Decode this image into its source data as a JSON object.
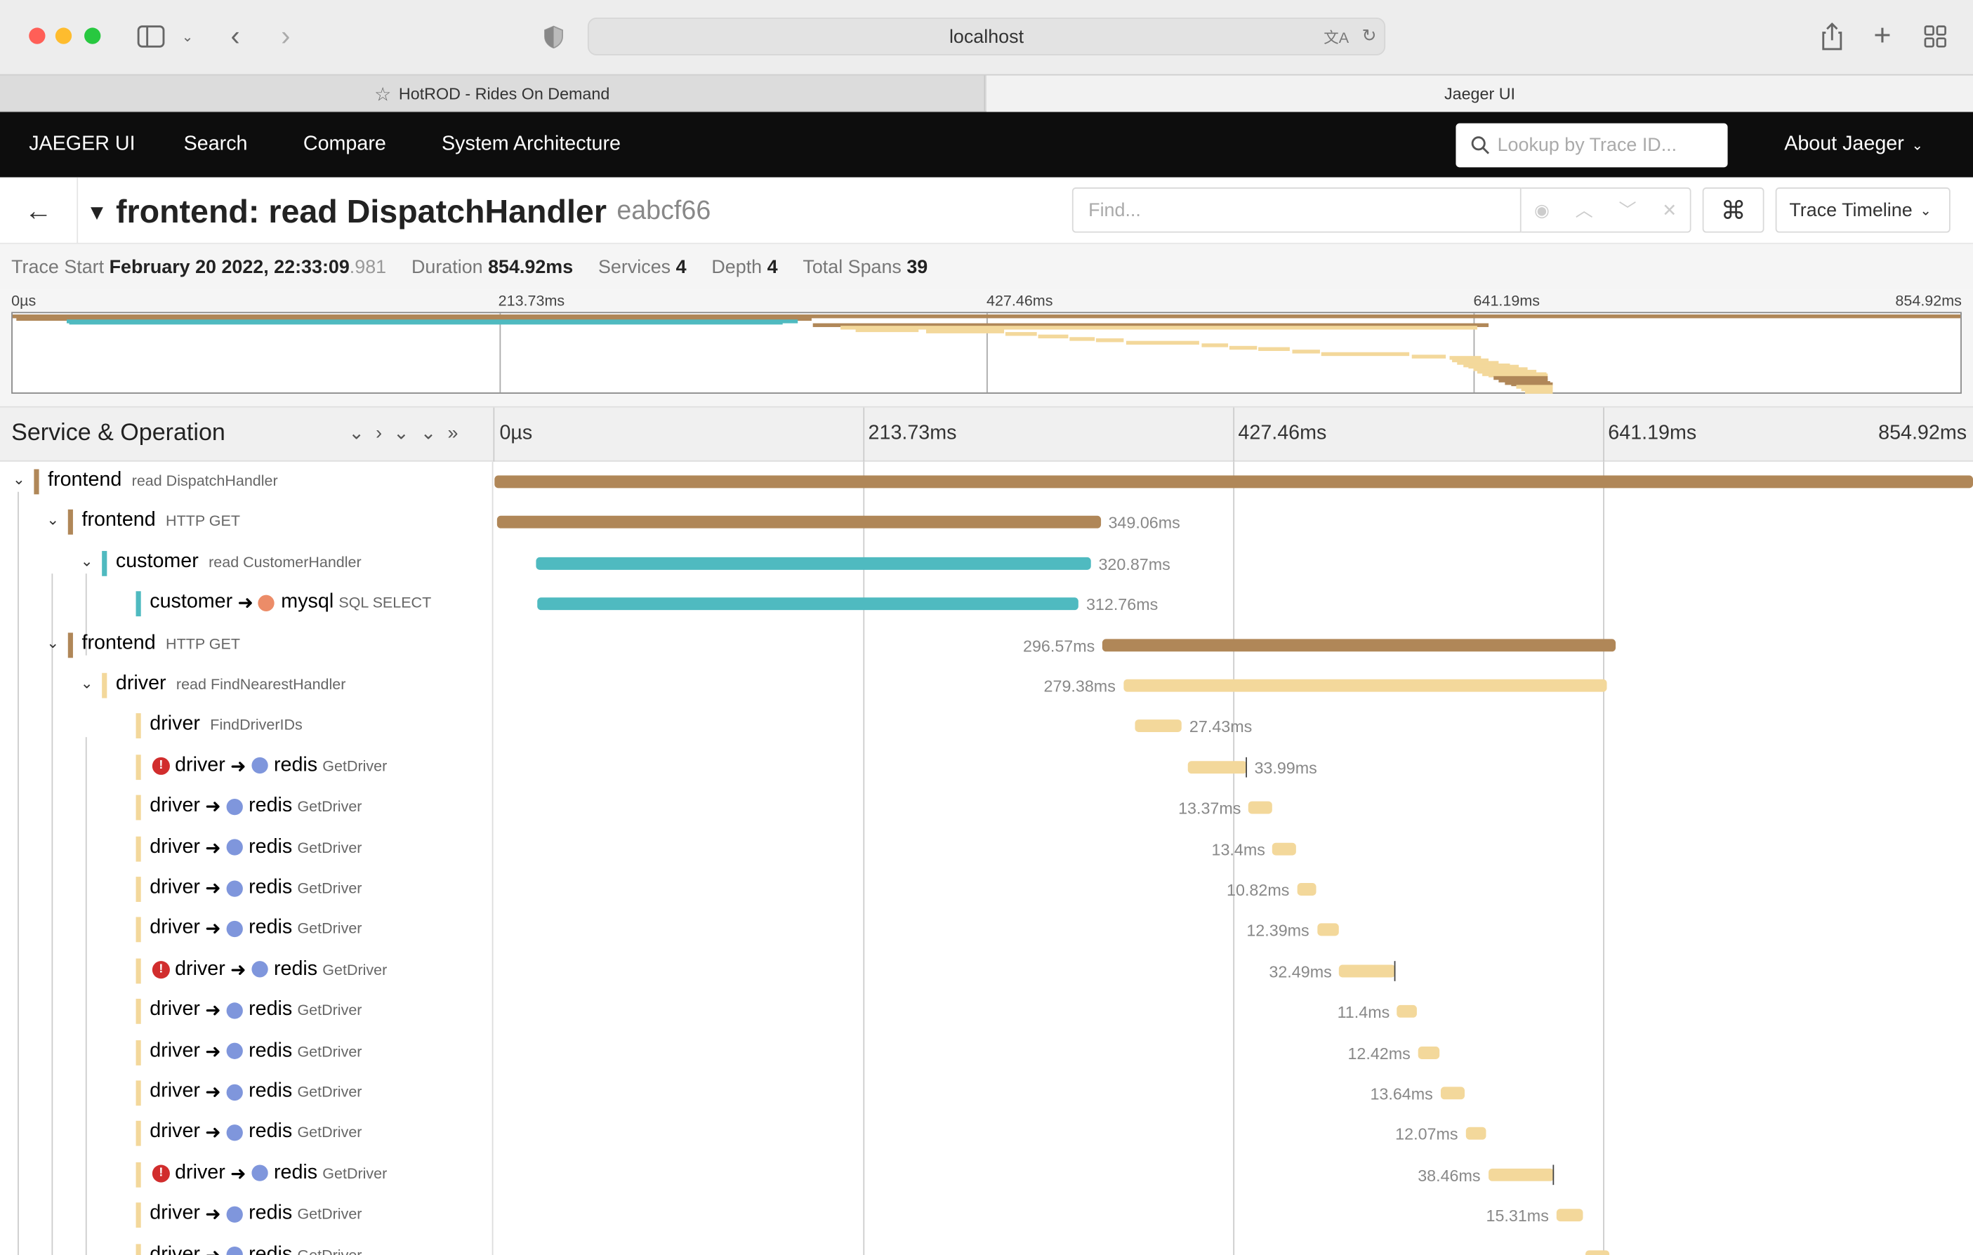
{
  "browser": {
    "url": "localhost",
    "tabs": [
      {
        "label": "HotROD - Rides On Demand"
      },
      {
        "label": "Jaeger UI"
      }
    ]
  },
  "nav": {
    "brand": "JAEGER UI",
    "items": [
      "Search",
      "Compare",
      "System Architecture"
    ],
    "lookup_placeholder": "Lookup by Trace ID...",
    "about": "About Jaeger"
  },
  "trace": {
    "title": "frontend: read DispatchHandler",
    "trace_id": "eabcf66",
    "find_placeholder": "Find...",
    "view_select": "Trace Timeline"
  },
  "summary": {
    "start_label": "Trace Start",
    "start_value": "February 20 2022, 22:33:09",
    "start_ms": ".981",
    "duration_label": "Duration",
    "duration_value": "854.92ms",
    "services_label": "Services",
    "services_value": "4",
    "depth_label": "Depth",
    "depth_value": "4",
    "spans_label": "Total Spans",
    "spans_value": "39"
  },
  "timeline": {
    "header_title": "Service & Operation",
    "ticks": [
      "0µs",
      "213.73ms",
      "427.46ms",
      "641.19ms",
      "854.92ms"
    ],
    "total_ms": 854.92
  },
  "colors": {
    "frontend": "#b08758",
    "customer": "#4fbac0",
    "mysql": "#ec8c68",
    "driver": "#f3d89b",
    "redis": "#7f96dc",
    "error": "#d12d2d"
  },
  "spans": [
    {
      "depth": 0,
      "caret": true,
      "service": "frontend",
      "op": "read DispatchHandler",
      "start": 0,
      "duration": 854.92,
      "label": "",
      "labelSide": "none",
      "color": "frontend"
    },
    {
      "depth": 1,
      "caret": true,
      "service": "frontend",
      "op": "HTTP GET",
      "start": 1.5,
      "duration": 349.06,
      "label": "349.06ms",
      "labelSide": "right",
      "color": "frontend"
    },
    {
      "depth": 2,
      "caret": true,
      "service": "customer",
      "op": "read CustomerHandler",
      "start": 24,
      "duration": 320.87,
      "label": "320.87ms",
      "labelSide": "right",
      "color": "customer"
    },
    {
      "depth": 3,
      "caret": false,
      "service": "customer",
      "target": "mysql",
      "targetColor": "mysql",
      "op": "SQL SELECT",
      "start": 25,
      "duration": 312.76,
      "label": "312.76ms",
      "labelSide": "right",
      "color": "customer"
    },
    {
      "depth": 1,
      "caret": true,
      "service": "frontend",
      "op": "HTTP GET",
      "start": 351.5,
      "duration": 296.57,
      "label": "296.57ms",
      "labelSide": "left",
      "color": "frontend"
    },
    {
      "depth": 2,
      "caret": true,
      "service": "driver",
      "op": "read FindNearestHandler",
      "start": 363.5,
      "duration": 279.38,
      "label": "279.38ms",
      "labelSide": "left",
      "color": "driver"
    },
    {
      "depth": 3,
      "caret": false,
      "service": "driver",
      "op": "FindDriverIDs",
      "start": 370,
      "duration": 27.43,
      "label": "27.43ms",
      "labelSide": "right",
      "color": "driver"
    },
    {
      "depth": 3,
      "caret": false,
      "error": true,
      "service": "driver",
      "target": "redis",
      "targetColor": "redis",
      "op": "GetDriver",
      "start": 401,
      "duration": 33.99,
      "label": "33.99ms",
      "labelSide": "right",
      "color": "driver",
      "log": true
    },
    {
      "depth": 3,
      "caret": false,
      "service": "driver",
      "target": "redis",
      "targetColor": "redis",
      "op": "GetDriver",
      "start": 436,
      "duration": 13.37,
      "label": "13.37ms",
      "labelSide": "left",
      "color": "driver"
    },
    {
      "depth": 3,
      "caret": false,
      "service": "driver",
      "target": "redis",
      "targetColor": "redis",
      "op": "GetDriver",
      "start": 450,
      "duration": 13.4,
      "label": "13.4ms",
      "labelSide": "left",
      "color": "driver"
    },
    {
      "depth": 3,
      "caret": false,
      "service": "driver",
      "target": "redis",
      "targetColor": "redis",
      "op": "GetDriver",
      "start": 464,
      "duration": 10.82,
      "label": "10.82ms",
      "labelSide": "left",
      "color": "driver"
    },
    {
      "depth": 3,
      "caret": false,
      "service": "driver",
      "target": "redis",
      "targetColor": "redis",
      "op": "GetDriver",
      "start": 475.5,
      "duration": 12.39,
      "label": "12.39ms",
      "labelSide": "left",
      "color": "driver"
    },
    {
      "depth": 3,
      "caret": false,
      "error": true,
      "service": "driver",
      "target": "redis",
      "targetColor": "redis",
      "op": "GetDriver",
      "start": 488.5,
      "duration": 32.49,
      "label": "32.49ms",
      "labelSide": "left",
      "color": "driver",
      "log": true
    },
    {
      "depth": 3,
      "caret": false,
      "service": "driver",
      "target": "redis",
      "targetColor": "redis",
      "op": "GetDriver",
      "start": 522,
      "duration": 11.4,
      "label": "11.4ms",
      "labelSide": "left",
      "color": "driver"
    },
    {
      "depth": 3,
      "caret": false,
      "service": "driver",
      "target": "redis",
      "targetColor": "redis",
      "op": "GetDriver",
      "start": 534,
      "duration": 12.42,
      "label": "12.42ms",
      "labelSide": "left",
      "color": "driver"
    },
    {
      "depth": 3,
      "caret": false,
      "service": "driver",
      "target": "redis",
      "targetColor": "redis",
      "op": "GetDriver",
      "start": 547,
      "duration": 13.64,
      "label": "13.64ms",
      "labelSide": "left",
      "color": "driver"
    },
    {
      "depth": 3,
      "caret": false,
      "service": "driver",
      "target": "redis",
      "targetColor": "redis",
      "op": "GetDriver",
      "start": 561.5,
      "duration": 12.07,
      "label": "12.07ms",
      "labelSide": "left",
      "color": "driver"
    },
    {
      "depth": 3,
      "caret": false,
      "error": true,
      "service": "driver",
      "target": "redis",
      "targetColor": "redis",
      "op": "GetDriver",
      "start": 574.5,
      "duration": 38.46,
      "label": "38.46ms",
      "labelSide": "left",
      "color": "driver",
      "log": true
    },
    {
      "depth": 3,
      "caret": false,
      "service": "driver",
      "target": "redis",
      "targetColor": "redis",
      "op": "GetDriver",
      "start": 614,
      "duration": 15.31,
      "label": "15.31ms",
      "labelSide": "left",
      "color": "driver"
    },
    {
      "depth": 3,
      "caret": false,
      "service": "driver",
      "target": "redis",
      "targetColor": "redis",
      "op": "GetDriver",
      "start": 630.5,
      "duration": 14,
      "label": "",
      "labelSide": "none",
      "color": "driver"
    }
  ]
}
